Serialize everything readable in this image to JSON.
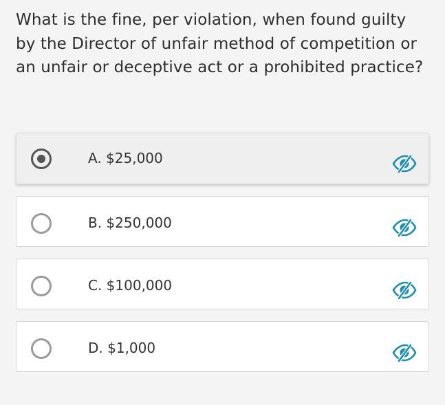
{
  "question": {
    "text": "What is the fine, per violation, when found guilty by the Director of unfair method of competition or an unfair or deceptive act or a prohibited practice?"
  },
  "options": [
    {
      "label": "A. $25,000",
      "selected": true
    },
    {
      "label": "B. $250,000",
      "selected": false
    },
    {
      "label": "C. $100,000",
      "selected": false
    },
    {
      "label": "D. $1,000",
      "selected": false
    }
  ],
  "icons": {
    "eliminate": "eye-slash-icon"
  },
  "colors": {
    "accent": "#1a8fb0",
    "radio_selected": "#555555",
    "radio_unselected": "#9a9a9a",
    "selected_bg": "#efefef"
  }
}
